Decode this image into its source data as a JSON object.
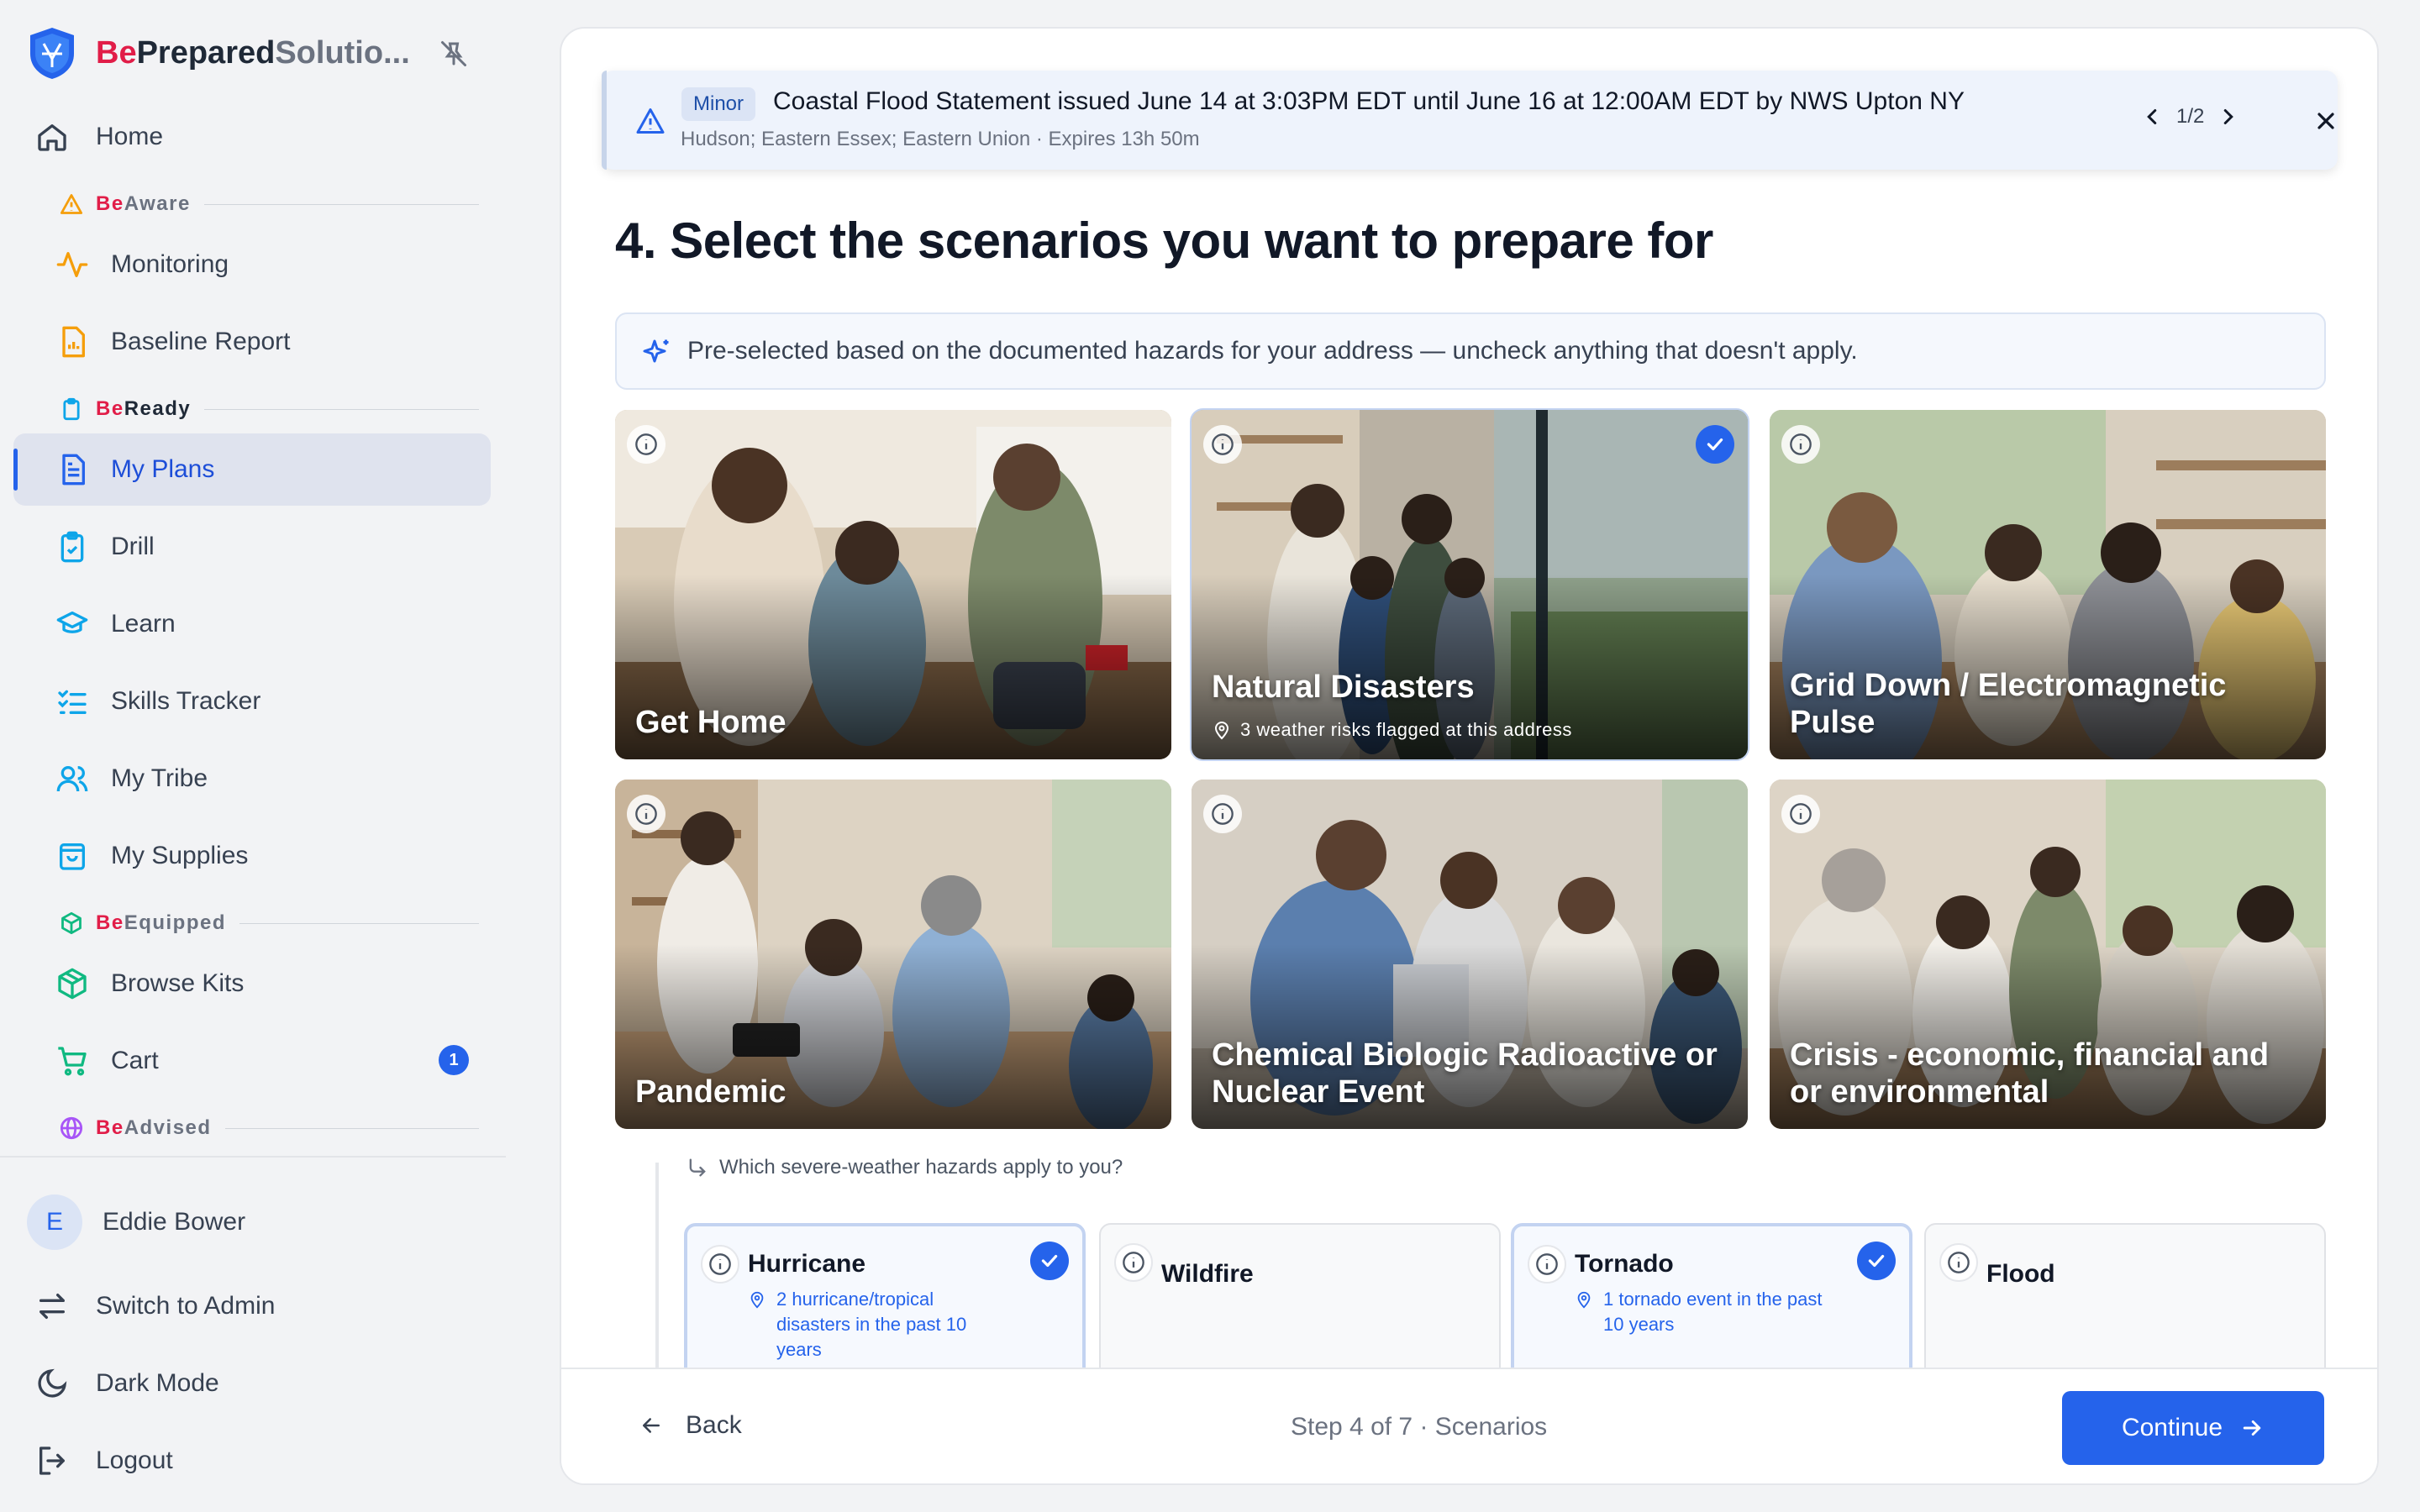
{
  "brand": {
    "be": "Be",
    "prepared": "Prepared",
    "solutions": "Solutio..."
  },
  "sidebar": {
    "home": "Home",
    "sections": {
      "aware": {
        "be": "Be",
        "rest": "Aware"
      },
      "ready": {
        "be": "Be",
        "rest": "Ready"
      },
      "equipped": {
        "be": "Be",
        "rest": "Equipped"
      },
      "advised": {
        "be": "Be",
        "rest": "Advised"
      }
    },
    "items": {
      "monitoring": "Monitoring",
      "baseline_report": "Baseline Report",
      "my_plans": "My Plans",
      "drill": "Drill",
      "learn": "Learn",
      "skills_tracker": "Skills Tracker",
      "my_tribe": "My Tribe",
      "my_supplies": "My Supplies",
      "browse_kits": "Browse Kits",
      "cart": "Cart"
    },
    "cart_count": "1",
    "user": {
      "initial": "E",
      "name": "Eddie Bower"
    },
    "switch_admin": "Switch to Admin",
    "dark_mode": "Dark Mode",
    "logout": "Logout"
  },
  "alert": {
    "severity": "Minor",
    "title": "Coastal Flood Statement issued June 14 at 3:03PM EDT until June 16 at 12:00AM EDT by NWS Upton NY",
    "subtitle": "Hudson; Eastern Essex; Eastern Union · Expires 13h 50m",
    "pager": "1/2"
  },
  "page": {
    "title": "4. Select the scenarios you want to prepare for",
    "hint": "Pre-selected based on the documented hazards for your address — uncheck anything that doesn't apply."
  },
  "scenarios": [
    {
      "label": "Get Home",
      "selected": false
    },
    {
      "label": "Natural Disasters",
      "subtitle": "3 weather risks flagged at this address",
      "selected": true
    },
    {
      "label": "Grid Down / Electromagnetic Pulse",
      "selected": false
    },
    {
      "label": "Pandemic",
      "selected": false
    },
    {
      "label": "Chemical Biologic Radioactive or Nuclear Event",
      "selected": false
    },
    {
      "label": "Crisis - economic, financial and or environmental",
      "selected": false
    }
  ],
  "hazards": {
    "question": "Which severe-weather hazards apply to you?",
    "items": [
      {
        "name": "Hurricane",
        "detail": "2 hurricane/tropical disasters in the past 10 years",
        "selected": true
      },
      {
        "name": "Wildfire",
        "selected": false
      },
      {
        "name": "Tornado",
        "detail": "1 tornado event in the past 10 years",
        "selected": true
      },
      {
        "name": "Flood",
        "selected": false
      }
    ]
  },
  "footer": {
    "back": "Back",
    "step": "Step 4 of 7 · Scenarios",
    "continue": "Continue"
  },
  "colors": {
    "accent": "#2563eb",
    "brand_red": "#e11d48",
    "active_bg": "#dfe3ee"
  }
}
